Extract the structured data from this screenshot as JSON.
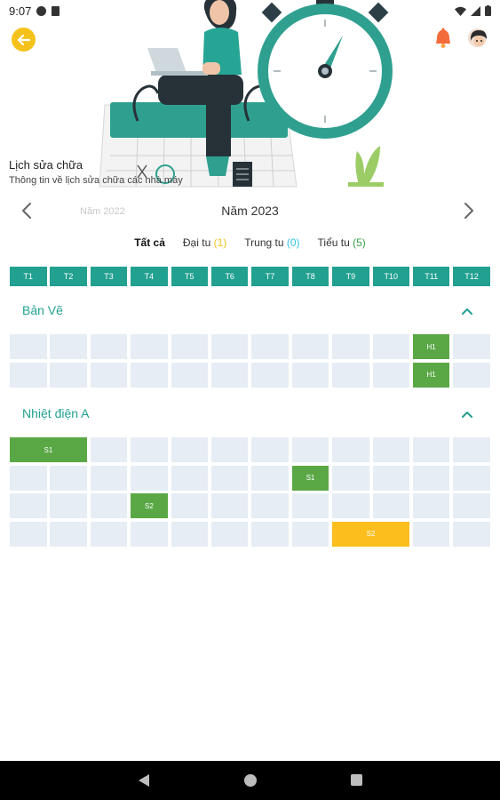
{
  "status_bar": {
    "time": "9:07"
  },
  "header": {
    "title": "Lịch sửa chữa",
    "subtitle": "Thông tin về lịch sửa chữa các nhà máy"
  },
  "year_nav": {
    "previous_year": "Năm 2022",
    "current_year": "Năm 2023"
  },
  "filters": {
    "all": "Tất cả",
    "major_label": "Đại tu",
    "major_count": "(1)",
    "mid_label": "Trung tu",
    "mid_count": "(0)",
    "minor_label": "Tiểu tu",
    "minor_count": "(5)"
  },
  "months": [
    "T1",
    "T2",
    "T3",
    "T4",
    "T5",
    "T6",
    "T7",
    "T8",
    "T9",
    "T10",
    "T11",
    "T12"
  ],
  "sections": [
    {
      "title": "Bản Vẽ",
      "rows": [
        [
          {
            "label": "H1",
            "start": 11,
            "span": 1,
            "color": "green"
          }
        ],
        [
          {
            "label": "H1",
            "start": 11,
            "span": 1,
            "color": "green"
          }
        ]
      ]
    },
    {
      "title": "Nhiệt điện A",
      "rows": [
        [
          {
            "label": "S1",
            "start": 1,
            "span": 2,
            "color": "green"
          }
        ],
        [
          {
            "label": "S1",
            "start": 8,
            "span": 1,
            "color": "green"
          }
        ],
        [
          {
            "label": "S2",
            "start": 4,
            "span": 1,
            "color": "green"
          }
        ],
        [
          {
            "label": "S2",
            "start": 9,
            "span": 2,
            "color": "yellow"
          }
        ]
      ]
    }
  ],
  "colors": {
    "accent": "#22a090",
    "back_button": "#f5c21b",
    "bar_green": "#5aa845",
    "bar_yellow": "#fbbe1c",
    "empty_cell": "#e6edf4"
  }
}
